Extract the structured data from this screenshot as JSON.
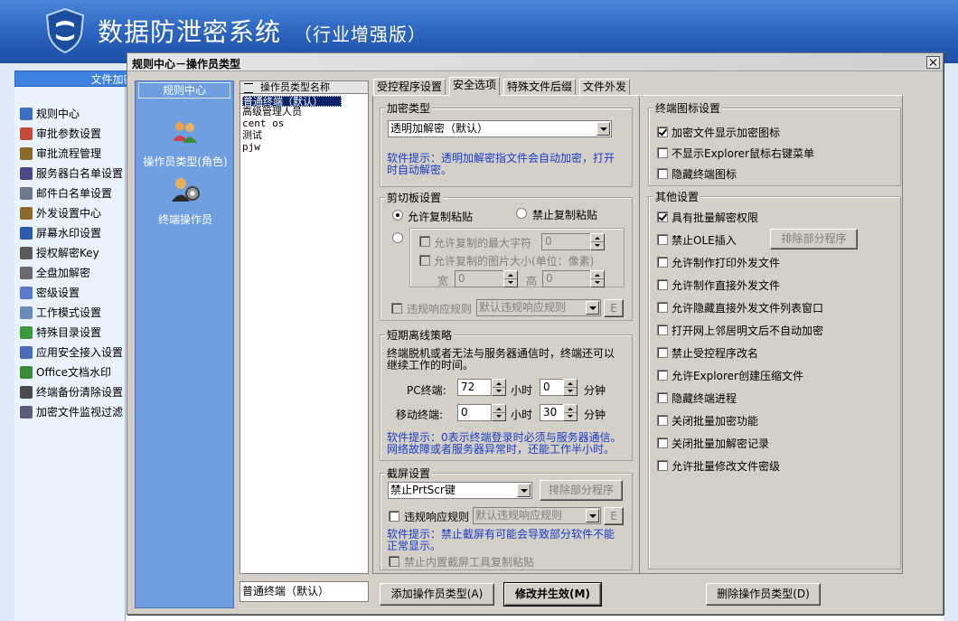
{
  "app": {
    "title": "数据防泄密系统",
    "edition": "（行业增强版）"
  },
  "sidebar": {
    "header": "文件加密",
    "items": [
      {
        "label": "规则中心",
        "icon": "rules-icon",
        "color": "#3a6fc4"
      },
      {
        "label": "审批参数设置",
        "icon": "approval-params-icon",
        "color": "#c44a3a"
      },
      {
        "label": "审批流程管理",
        "icon": "workflow-icon",
        "color": "#8a6a2a"
      },
      {
        "label": "服务器白名单设置",
        "icon": "server-icon",
        "color": "#4a4a8a"
      },
      {
        "label": "邮件白名单设置",
        "icon": "mail-icon",
        "color": "#6a7a8a"
      },
      {
        "label": "外发设置中心",
        "icon": "outgoing-icon",
        "color": "#8a6a2a"
      },
      {
        "label": "屏幕水印设置",
        "icon": "screen-watermark-icon",
        "color": "#2a5aa8"
      },
      {
        "label": "授权解密Key",
        "icon": "key-icon",
        "color": "#5a5a5a"
      },
      {
        "label": "全盘加解密",
        "icon": "disk-icon",
        "color": "#6a6a6a"
      },
      {
        "label": "密级设置",
        "icon": "secret-level-icon",
        "color": "#5a7ac8"
      },
      {
        "label": "工作模式设置",
        "icon": "work-mode-icon",
        "color": "#6a8ab8"
      },
      {
        "label": "特殊目录设置",
        "icon": "folder-icon",
        "color": "#3a9a3a"
      },
      {
        "label": "应用安全接入设置",
        "icon": "app-access-icon",
        "color": "#4a6ab8"
      },
      {
        "label": "Office文档水印",
        "icon": "office-watermark-icon",
        "color": "#3a8a3a"
      },
      {
        "label": "终端备份清除设置",
        "icon": "backup-icon",
        "color": "#4a4a4a"
      },
      {
        "label": "加密文件监视过滤",
        "icon": "monitor-filter-icon",
        "color": "#5a5a7a"
      }
    ]
  },
  "dialog": {
    "title": "规则中心－操作员类型",
    "rule_pane": {
      "header": "规则中心",
      "items": [
        {
          "label": "操作员类型(角色)",
          "icon": "operator-type-icon"
        },
        {
          "label": "终端操作员",
          "icon": "terminal-operator-icon"
        }
      ]
    },
    "type_list": {
      "column": "操作员类型名称",
      "rows": [
        "普通终端（默认）",
        "高级管理人员",
        "cent os",
        "测试",
        "pjw"
      ],
      "selected_index": 0
    },
    "current_type": "普通终端（默认）",
    "tabs": [
      "受控程序设置",
      "安全选项",
      "特殊文件后缀",
      "文件外发"
    ],
    "active_tab": "安全选项",
    "encryption": {
      "group": "加密类型",
      "value": "透明加解密（默认）",
      "hint": "软件提示：透明加解密指文件会自动加密，打开时自动解密。"
    },
    "clipboard": {
      "group": "剪切板设置",
      "allow": "允许复制粘贴",
      "forbid": "禁止复制粘贴",
      "max_chars_label": "允许复制的最大字符",
      "max_chars_value": "0",
      "img_size_label": "允许复制的图片大小(单位：像素)",
      "width_label": "宽",
      "width_value": "0",
      "height_label": "高",
      "height_value": "0",
      "violation_label": "违规响应规则",
      "violation_value": "默认违规响应规则",
      "edit_btn": "E"
    },
    "offline": {
      "group": "短期离线策略",
      "desc": "终端脱机或者无法与服务器通信时，终端还可以继续工作的时间。",
      "pc_label": "PC终端:",
      "pc_hours": "72",
      "pc_minutes": "0",
      "mobile_label": "移动终端:",
      "mobile_hours": "0",
      "mobile_minutes": "30",
      "hour_unit": "小时",
      "minute_unit": "分钟",
      "hint": "软件提示：0表示终端登录时必须与服务器通信。网络故障或者服务器异常时，还能工作半小时。"
    },
    "screenshot": {
      "group": "截屏设置",
      "value": "禁止PrtScr键",
      "exclude_btn": "排除部分程序",
      "violation_label": "违规响应规则",
      "violation_value": "默认违规响应规则",
      "edit_btn": "E",
      "hint": "软件提示：禁止截屏有可能会导致部分软件不能正常显示。",
      "builtin_label": "禁止内置截屏工具复制粘贴"
    },
    "icon_settings": {
      "group": "终端图标设置",
      "options": [
        {
          "label": "加密文件显示加密图标",
          "checked": true
        },
        {
          "label": "不显示Explorer鼠标右键菜单",
          "checked": false
        },
        {
          "label": "隐藏终端图标",
          "checked": false
        }
      ]
    },
    "other_settings": {
      "group": "其他设置",
      "exclude_btn": "排除部分程序",
      "options": [
        {
          "label": "具有批量解密权限",
          "checked": true
        },
        {
          "label": "禁止OLE插入",
          "checked": false
        },
        {
          "label": "允许制作打印外发文件",
          "checked": false
        },
        {
          "label": "允许制作直接外发文件",
          "checked": false
        },
        {
          "label": "允许隐藏直接外发文件列表窗口",
          "checked": false
        },
        {
          "label": "打开网上邻居明文后不自动加密",
          "checked": false
        },
        {
          "label": "禁止受控程序改名",
          "checked": false
        },
        {
          "label": "允许Explorer创建压缩文件",
          "checked": false
        },
        {
          "label": "隐藏终端进程",
          "checked": false
        },
        {
          "label": "关闭批量加密功能",
          "checked": false
        },
        {
          "label": "关闭批量加解密记录",
          "checked": false
        },
        {
          "label": "允许批量修改文件密级",
          "checked": false
        }
      ]
    },
    "buttons": {
      "add": "添加操作员类型(A)",
      "apply": "修改并生效(M)",
      "delete": "删除操作员类型(D)"
    }
  }
}
